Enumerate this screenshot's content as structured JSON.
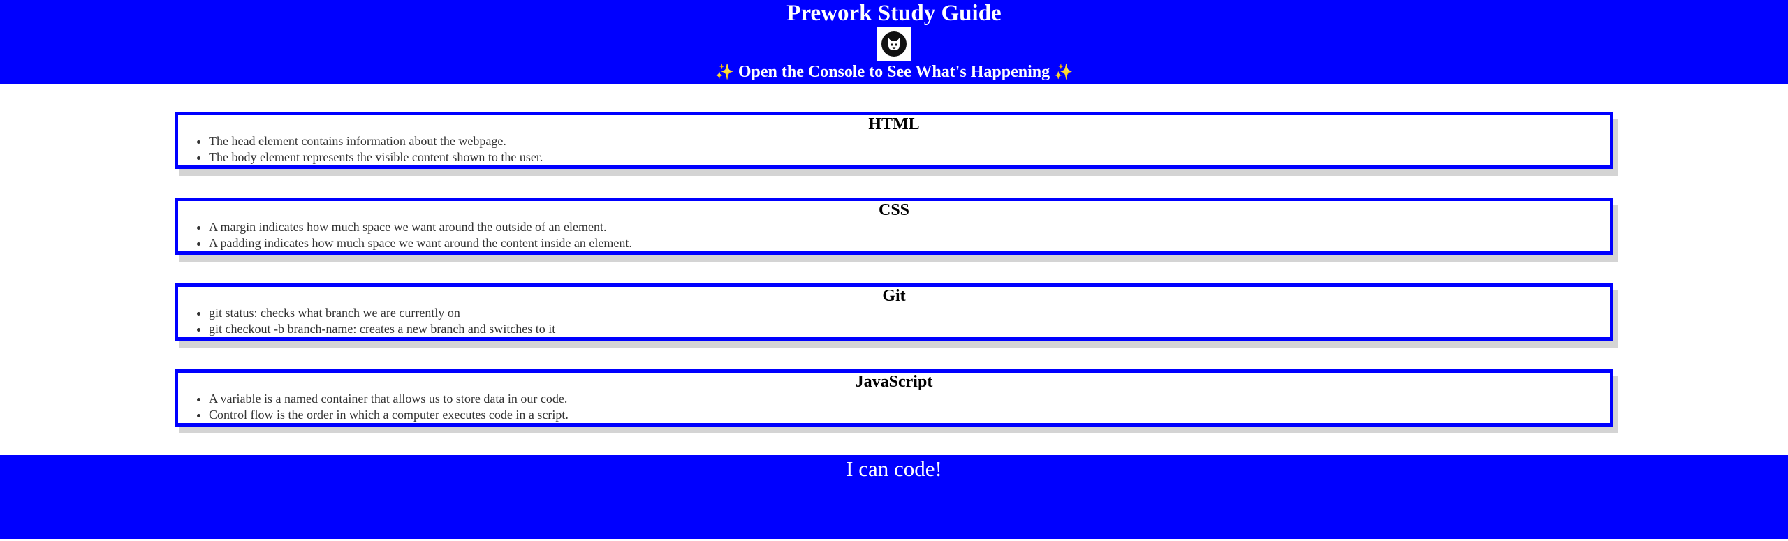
{
  "header": {
    "title": "Prework Study Guide",
    "logo_icon": "cat-logo-icon",
    "subtitle": "Open the Console to See What's Happening",
    "sparkle_left": "✨",
    "sparkle_right": "✨"
  },
  "sections": [
    {
      "title": "HTML",
      "items": [
        "The head element contains information about the webpage.",
        "The body element represents the visible content shown to the user."
      ]
    },
    {
      "title": "CSS",
      "items": [
        "A margin indicates how much space we want around the outside of an element.",
        "A padding indicates how much space we want around the content inside an element."
      ]
    },
    {
      "title": "Git",
      "items": [
        "git status: checks what branch we are currently on",
        "git checkout -b branch-name: creates a new branch and switches to it"
      ]
    },
    {
      "title": "JavaScript",
      "items": [
        "A variable is a named container that allows us to store data in our code.",
        "Control flow is the order in which a computer executes code in a script."
      ]
    }
  ],
  "footer": {
    "text": "I can code!"
  },
  "colors": {
    "accent": "#0000ff",
    "shadow": "#d4d4d4"
  }
}
